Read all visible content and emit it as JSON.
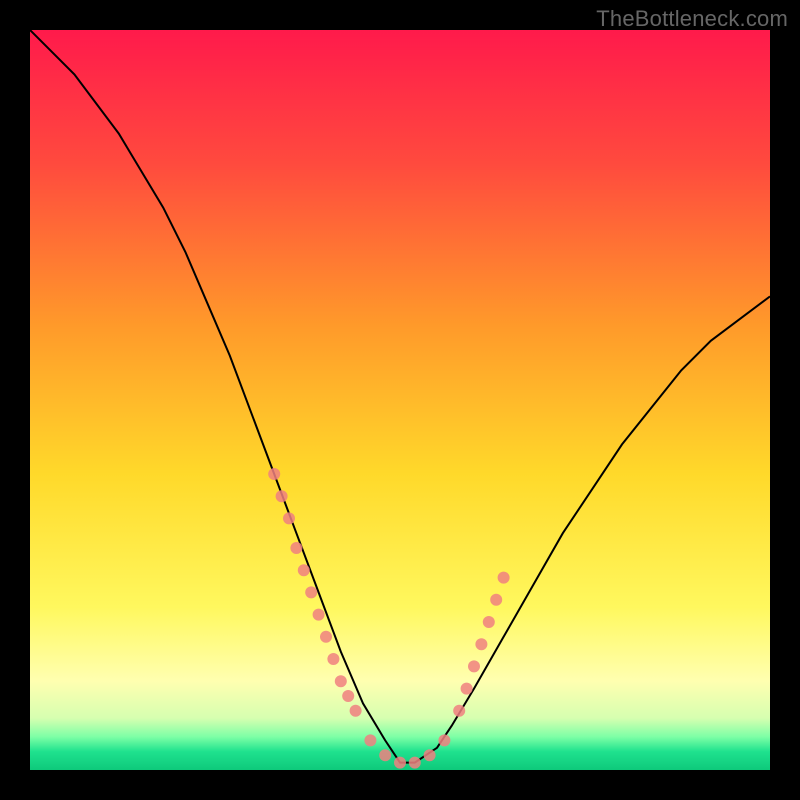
{
  "watermark": "TheBottleneck.com",
  "chart_data": {
    "type": "line",
    "title": "",
    "xlabel": "",
    "ylabel": "",
    "xlim": [
      0,
      100
    ],
    "ylim": [
      0,
      100
    ],
    "grid": false,
    "legend": false,
    "background_gradient": {
      "stops": [
        {
          "offset": 0.0,
          "color": "#ff1a4b"
        },
        {
          "offset": 0.18,
          "color": "#ff4a3e"
        },
        {
          "offset": 0.4,
          "color": "#ff9a2a"
        },
        {
          "offset": 0.6,
          "color": "#ffd92a"
        },
        {
          "offset": 0.78,
          "color": "#fff85e"
        },
        {
          "offset": 0.88,
          "color": "#ffffb0"
        },
        {
          "offset": 0.93,
          "color": "#d6ffb0"
        },
        {
          "offset": 0.955,
          "color": "#7effa6"
        },
        {
          "offset": 0.975,
          "color": "#1fe28e"
        },
        {
          "offset": 1.0,
          "color": "#0ec97b"
        }
      ]
    },
    "series": [
      {
        "name": "bottleneck-curve",
        "stroke": "#000000",
        "stroke_width": 2,
        "x": [
          0,
          3,
          6,
          9,
          12,
          15,
          18,
          21,
          24,
          27,
          30,
          33,
          36,
          39,
          42,
          45,
          48,
          50,
          52,
          55,
          57,
          60,
          64,
          68,
          72,
          76,
          80,
          84,
          88,
          92,
          96,
          100
        ],
        "y": [
          100,
          97,
          94,
          90,
          86,
          81,
          76,
          70,
          63,
          56,
          48,
          40,
          32,
          24,
          16,
          9,
          4,
          1,
          1,
          3,
          6,
          11,
          18,
          25,
          32,
          38,
          44,
          49,
          54,
          58,
          61,
          64
        ]
      }
    ],
    "marker_clusters": [
      {
        "name": "left-cluster",
        "color": "#f08080",
        "r": 6,
        "points": [
          {
            "x": 33,
            "y": 40
          },
          {
            "x": 34,
            "y": 37
          },
          {
            "x": 35,
            "y": 34
          },
          {
            "x": 36,
            "y": 30
          },
          {
            "x": 37,
            "y": 27
          },
          {
            "x": 38,
            "y": 24
          },
          {
            "x": 39,
            "y": 21
          },
          {
            "x": 40,
            "y": 18
          },
          {
            "x": 41,
            "y": 15
          },
          {
            "x": 42,
            "y": 12
          },
          {
            "x": 43,
            "y": 10
          },
          {
            "x": 44,
            "y": 8
          }
        ]
      },
      {
        "name": "bottom-cluster",
        "color": "#f08080",
        "r": 6,
        "points": [
          {
            "x": 46,
            "y": 4
          },
          {
            "x": 48,
            "y": 2
          },
          {
            "x": 50,
            "y": 1
          },
          {
            "x": 52,
            "y": 1
          },
          {
            "x": 54,
            "y": 2
          },
          {
            "x": 56,
            "y": 4
          }
        ]
      },
      {
        "name": "right-cluster",
        "color": "#f08080",
        "r": 6,
        "points": [
          {
            "x": 58,
            "y": 8
          },
          {
            "x": 59,
            "y": 11
          },
          {
            "x": 60,
            "y": 14
          },
          {
            "x": 61,
            "y": 17
          },
          {
            "x": 62,
            "y": 20
          },
          {
            "x": 63,
            "y": 23
          },
          {
            "x": 64,
            "y": 26
          }
        ]
      }
    ]
  }
}
